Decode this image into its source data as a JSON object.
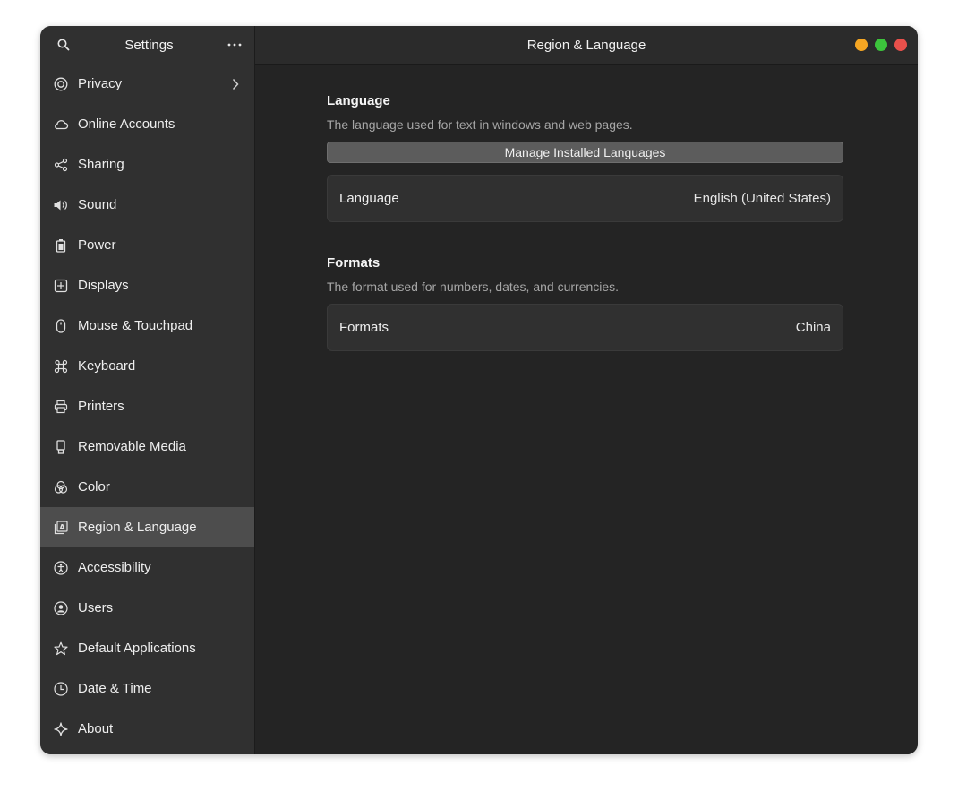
{
  "sidebar": {
    "title": "Settings",
    "search_icon": "search-icon",
    "menu_icon": "more-icon",
    "items": [
      {
        "label": "Privacy",
        "icon": "privacy-icon",
        "has_chevron": true
      },
      {
        "label": "Online Accounts",
        "icon": "cloud-icon"
      },
      {
        "label": "Sharing",
        "icon": "share-icon"
      },
      {
        "label": "Sound",
        "icon": "speaker-icon"
      },
      {
        "label": "Power",
        "icon": "power-icon"
      },
      {
        "label": "Displays",
        "icon": "display-icon"
      },
      {
        "label": "Mouse & Touchpad",
        "icon": "mouse-icon"
      },
      {
        "label": "Keyboard",
        "icon": "keyboard-icon"
      },
      {
        "label": "Printers",
        "icon": "printer-icon"
      },
      {
        "label": "Removable Media",
        "icon": "usb-icon"
      },
      {
        "label": "Color",
        "icon": "color-icon"
      },
      {
        "label": "Region & Language",
        "icon": "region-language-icon",
        "active": true
      },
      {
        "label": "Accessibility",
        "icon": "accessibility-icon"
      },
      {
        "label": "Users",
        "icon": "user-icon"
      },
      {
        "label": "Default Applications",
        "icon": "star-icon"
      },
      {
        "label": "Date & Time",
        "icon": "clock-icon"
      },
      {
        "label": "About",
        "icon": "sparkle-icon"
      }
    ]
  },
  "header": {
    "title": "Region & Language"
  },
  "window_controls": {
    "minimize_color": "#f5a623",
    "maximize_color": "#3cc43c",
    "close_color": "#e9504b"
  },
  "language_section": {
    "title": "Language",
    "description": "The language used for text in windows and web pages.",
    "manage_button": "Manage Installed Languages",
    "row_label": "Language",
    "row_value": "English (United States)"
  },
  "formats_section": {
    "title": "Formats",
    "description": "The format used for numbers, dates, and currencies.",
    "row_label": "Formats",
    "row_value": "China"
  }
}
